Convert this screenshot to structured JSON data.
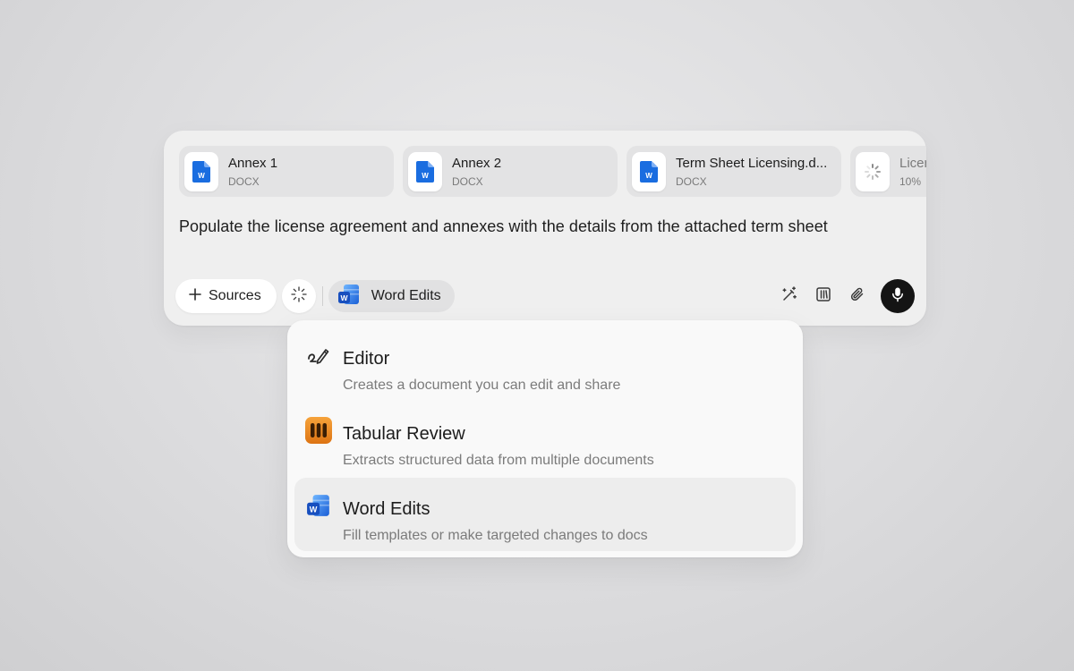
{
  "attachments": [
    {
      "name": "Annex 1",
      "type": "DOCX",
      "icon": "word-doc-icon"
    },
    {
      "name": "Annex 2",
      "type": "DOCX",
      "icon": "word-doc-icon"
    },
    {
      "name": "Term Sheet Licensing.d...",
      "type": "DOCX",
      "icon": "word-doc-icon"
    },
    {
      "name": "Licen",
      "type": "10%",
      "icon": "loading-spinner-icon"
    }
  ],
  "prompt": {
    "text": "Populate the license agreement and annexes with the details from the attached term sheet"
  },
  "toolbar": {
    "sources_label": "Sources",
    "mode_label": "Word Edits",
    "icons": [
      "plus-icon",
      "magic-sparkle-icon",
      "word-icon",
      "pen-sparkle-icon",
      "library-icon",
      "paperclip-icon",
      "microphone-icon"
    ]
  },
  "menu": {
    "items": [
      {
        "title": "Editor",
        "description": "Creates a document you can edit and share",
        "icon": "editor-pen-icon"
      },
      {
        "title": "Tabular Review",
        "description": "Extracts structured data from multiple documents",
        "icon": "tabular-review-icon"
      },
      {
        "title": "Word Edits",
        "description": "Fill templates or make targeted changes to docs",
        "icon": "word-icon"
      }
    ],
    "selected": "Word Edits"
  },
  "colors": {
    "word_blue": "#1a6de0",
    "tabular_orange": "#e8871c",
    "mic_bg": "#141414"
  }
}
